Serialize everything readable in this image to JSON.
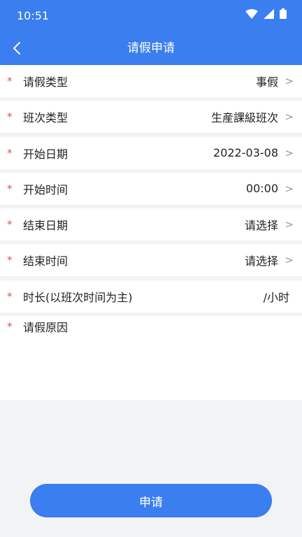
{
  "status": {
    "time": "10:51"
  },
  "nav": {
    "title": "请假申请"
  },
  "form": {
    "rows": [
      {
        "label": "请假类型",
        "value": "事假",
        "arrow": ">"
      },
      {
        "label": "班次类型",
        "value": "生産課級班次",
        "arrow": ">"
      },
      {
        "label": "开始日期",
        "value": "2022-03-08",
        "arrow": ">"
      },
      {
        "label": "开始时间",
        "value": "00:00",
        "arrow": ">"
      },
      {
        "label": "结束日期",
        "value": "请选择",
        "arrow": ">"
      },
      {
        "label": "结束时间",
        "value": "请选择",
        "arrow": ">"
      },
      {
        "label": "时长(以班次时间为主)",
        "value": "/小时"
      }
    ],
    "required_mark": "*",
    "reason": {
      "label": "请假原因",
      "value": ""
    }
  },
  "submit": {
    "label": "申请"
  },
  "colors": {
    "primary": "#3a7ef0",
    "required": "#e0504f",
    "background": "#f2f3f5"
  }
}
